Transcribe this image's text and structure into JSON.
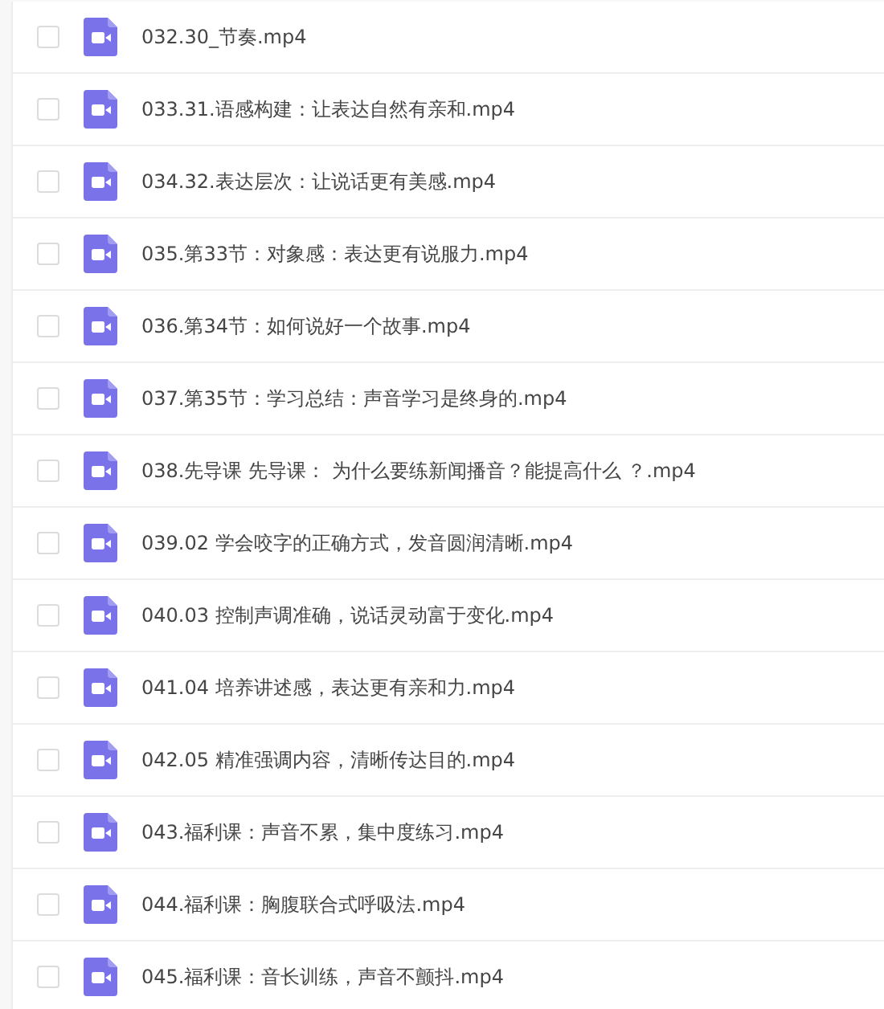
{
  "files": [
    {
      "name": "032.30_节奏.mp4",
      "checked": false
    },
    {
      "name": "033.31.语感构建：让表达自然有亲和.mp4",
      "checked": false
    },
    {
      "name": "034.32.表达层次：让说话更有美感.mp4",
      "checked": false
    },
    {
      "name": "035.第33节：对象感：表达更有说服力.mp4",
      "checked": false
    },
    {
      "name": "036.第34节：如何说好一个故事.mp4",
      "checked": false
    },
    {
      "name": "037.第35节：学习总结：声音学习是终身的.mp4",
      "checked": false
    },
    {
      "name": "038.先导课 先导课： 为什么要练新闻播音？能提高什么 ？.mp4",
      "checked": false
    },
    {
      "name": "039.02 学会咬字的正确方式，发音圆润清晰.mp4",
      "checked": false
    },
    {
      "name": "040.03 控制声调准确，说话灵动富于变化.mp4",
      "checked": false
    },
    {
      "name": "041.04 培养讲述感，表达更有亲和力.mp4",
      "checked": false
    },
    {
      "name": "042.05 精准强调内容，清晰传达目的.mp4",
      "checked": false
    },
    {
      "name": "043.福利课：声音不累，集中度练习.mp4",
      "checked": false
    },
    {
      "name": "044.福利课：胸腹联合式呼吸法.mp4",
      "checked": false
    },
    {
      "name": "045.福利课：音长训练，声音不颤抖.mp4",
      "checked": false
    }
  ]
}
